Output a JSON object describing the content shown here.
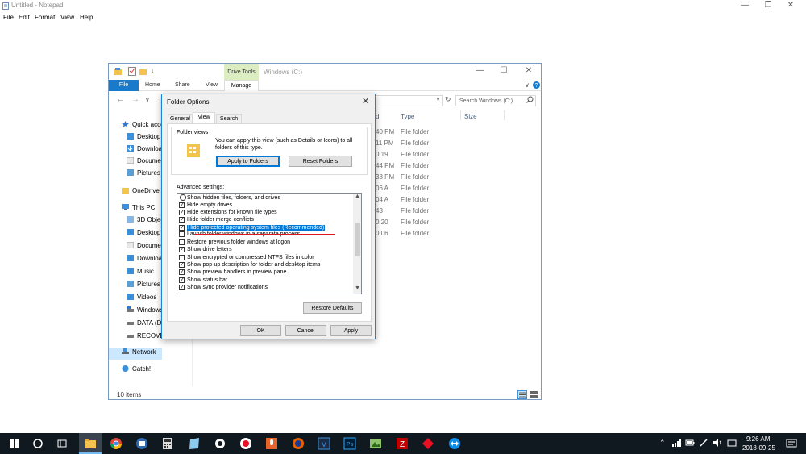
{
  "notepad": {
    "title": "Untitled - Notepad",
    "menu": [
      "File",
      "Edit",
      "Format",
      "View",
      "Help"
    ]
  },
  "explorer": {
    "contextual_tab": "Drive Tools",
    "title": "Windows (C:)",
    "tabs": {
      "file": "File",
      "home": "Home",
      "share": "Share",
      "view": "View",
      "manage": "Manage"
    },
    "search_placeholder": "Search Windows (C:)",
    "nav": {
      "quick_access": "Quick acce",
      "qa_items": [
        "Desktop",
        "Downloa",
        "Documen",
        "Pictures"
      ],
      "onedrive": "OneDrive",
      "this_pc": "This PC",
      "pc_items": [
        "3D Objec",
        "Desktop",
        "Documen",
        "Downloa",
        "Music",
        "Pictures",
        "Videos",
        "Windows",
        "DATA (D:",
        "RECOVER"
      ],
      "network": "Network",
      "catch": "Catch!"
    },
    "columns": {
      "date": "d",
      "type": "Type",
      "size": "Size"
    },
    "rows": [
      {
        "date": "40 PM",
        "type": "File folder"
      },
      {
        "date": "11 PM",
        "type": "File folder"
      },
      {
        "date": "0:19",
        "type": "File folder"
      },
      {
        "date": "44 PM",
        "type": "File folder"
      },
      {
        "date": "38 PM",
        "type": "File folder"
      },
      {
        "date": "06 A",
        "type": "File folder"
      },
      {
        "date": "04 A",
        "type": "File folder"
      },
      {
        "date": "43",
        "type": "File folder"
      },
      {
        "date": "0:20",
        "type": "File folder"
      },
      {
        "date": "0:06",
        "type": "File folder"
      }
    ],
    "status": "10 items"
  },
  "dialog": {
    "title": "Folder Options",
    "tabs": [
      "General",
      "View",
      "Search"
    ],
    "folder_views_label": "Folder views",
    "folder_views_desc": "You can apply this view (such as Details or Icons) to all folders of this type.",
    "apply_to_folders": "Apply to Folders",
    "reset_folders": "Reset Folders",
    "advanced_label": "Advanced settings:",
    "advanced_items": [
      {
        "label": "Show hidden files, folders, and drives",
        "kind": "radio",
        "checked": false
      },
      {
        "label": "Hide empty drives",
        "kind": "check",
        "checked": true
      },
      {
        "label": "Hide extensions for known file types",
        "kind": "check",
        "checked": true
      },
      {
        "label": "Hide folder merge conflicts",
        "kind": "check",
        "checked": true
      },
      {
        "label": "Hide protected operating system files (Recommended)",
        "kind": "check",
        "checked": true,
        "selected": true
      },
      {
        "label": "Launch folder windows in a separate process",
        "kind": "check",
        "checked": false
      },
      {
        "label": "Restore previous folder windows at logon",
        "kind": "check",
        "checked": false
      },
      {
        "label": "Show drive letters",
        "kind": "check",
        "checked": true
      },
      {
        "label": "Show encrypted or compressed NTFS files in color",
        "kind": "check",
        "checked": false
      },
      {
        "label": "Show pop-up description for folder and desktop items",
        "kind": "check",
        "checked": true
      },
      {
        "label": "Show preview handlers in preview pane",
        "kind": "check",
        "checked": true
      },
      {
        "label": "Show status bar",
        "kind": "check",
        "checked": true
      },
      {
        "label": "Show sync provider notifications",
        "kind": "check",
        "checked": true
      }
    ],
    "restore_defaults": "Restore Defaults",
    "ok": "OK",
    "cancel": "Cancel",
    "apply": "Apply"
  },
  "taskbar": {
    "time": "9:26 AM",
    "date": "2018-09-25"
  },
  "colors": {
    "accent": "#0078d7",
    "taskbar": "#101820",
    "highlight_underline": "#e81123"
  }
}
